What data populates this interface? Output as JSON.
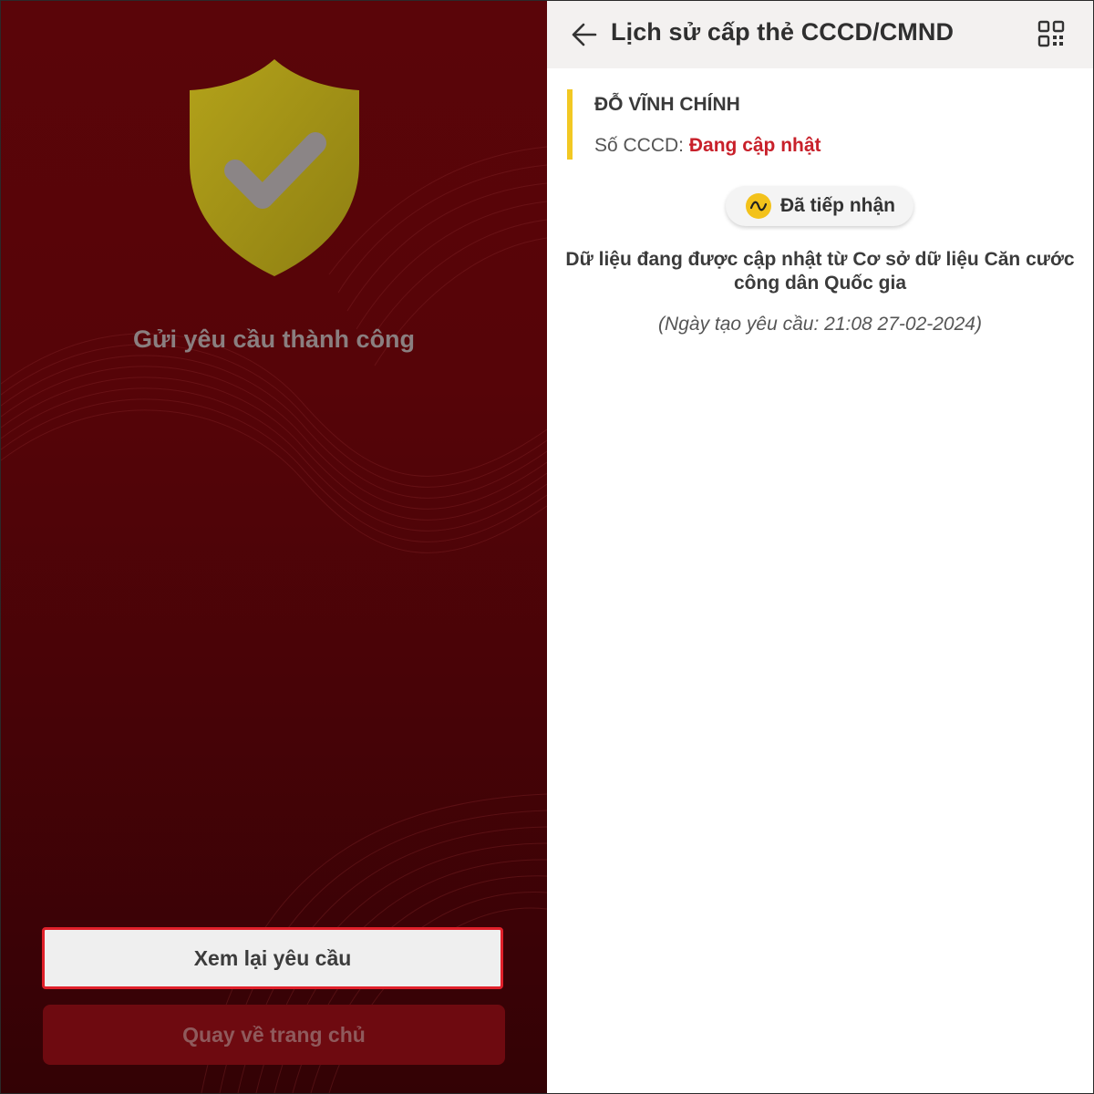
{
  "left_screen": {
    "success_message": "Gửi yêu cầu thành công",
    "review_button_label": "Xem lại yêu cầu",
    "home_button_label": "Quay về trang chủ",
    "shield_icon": "shield-check-icon",
    "accent_color": "#e0202a",
    "background_color": "#560408"
  },
  "right_screen": {
    "title": "Lịch sử cấp thẻ CCCD/CMND",
    "back_icon": "arrow-left-icon",
    "qr_icon": "qr-code-icon",
    "card": {
      "name": "ĐỖ VĨNH CHÍNH",
      "id_label": "Số CCCD: ",
      "id_value": "Đang cập nhật",
      "accent_color": "#f2c823",
      "id_value_color": "#c8202a"
    },
    "status_badge": {
      "label": "Đã tiếp nhận",
      "icon": "wave-icon",
      "icon_color": "#f3c21b"
    },
    "message": "Dữ liệu đang được cập nhật từ Cơ sở dữ liệu Căn cước công dân Quốc gia",
    "request_date": "(Ngày tạo yêu cầu: 21:08 27-02-2024)"
  }
}
